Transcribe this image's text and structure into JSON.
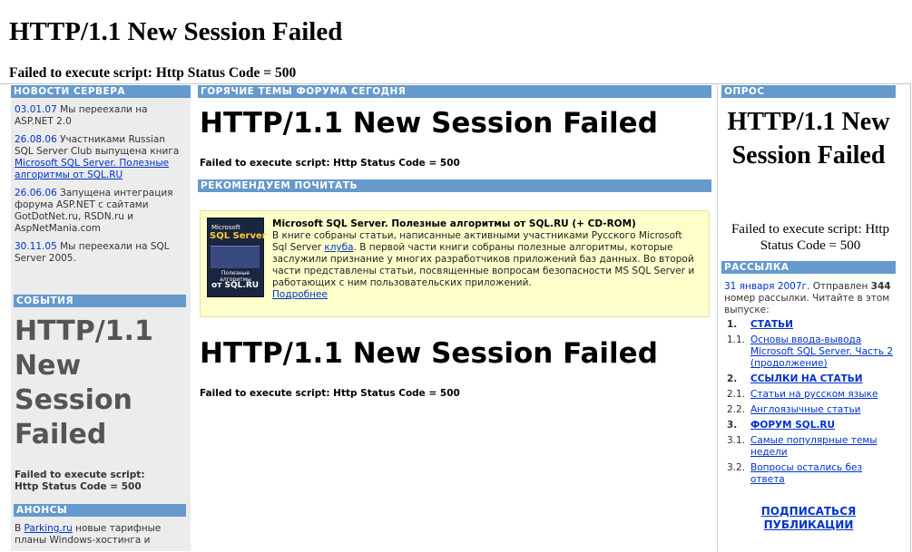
{
  "page": {
    "title": "HTTP/1.1 New Session Failed",
    "error": "Failed to execute script: Http Status Code = 500"
  },
  "left": {
    "news_header": "НОВОСТИ СЕРВЕРА",
    "news": [
      {
        "date": "03.01.07",
        "text": " Мы переехали на ASP.NET 2.0"
      },
      {
        "date": "26.08.06",
        "text": " Участниками Russian SQL Server Club выпущена книга ",
        "link": "Microsoft SQL Server. Полезные алгоритмы от SQL.RU"
      },
      {
        "date": "26.06.06",
        "text": " Запущена интеграция форума ASP.NET с сайтами GotDotNet.ru, RSDN.ru и AspNetMania.com"
      },
      {
        "date": "30.11.05",
        "text": " Мы переехали на SQL Server 2005."
      }
    ],
    "events_header": "СОБЫТИЯ",
    "events_title": "HTTP/1.1 New Session Failed",
    "events_error": "Failed to execute script: Http Status Code = 500",
    "anons_header": "АНОНСЫ",
    "anons_prefix": "В ",
    "anons_link": "Parking.ru",
    "anons_text": " новые тарифные планы Windows-хостинга и"
  },
  "center": {
    "forum_header": "ГОРЯЧИЕ ТЕМЫ ФОРУМА СЕГОДНЯ",
    "error_title_1": "HTTP/1.1 New Session Failed",
    "error_text_1": "Failed to execute script: Http Status Code = 500",
    "recommend_header": "РЕКОМЕНДУЕМ ПОЧИТАТЬ",
    "book": {
      "cover_top_small": "Microsoft",
      "cover_title": "SQL Server",
      "cover_sub": "Полезные алгоритмы",
      "cover_brand": "от SQL.RU",
      "title": "Microsoft SQL Server. Полезные алгоритмы от SQL.RU (+ CD-ROM)",
      "desc_before_link": "В книге собраны статьи, написанные активными участниками Русского Microsoft Sql Server ",
      "desc_link": "клуба",
      "desc_after_link": ". В первой части книги собраны полезные алгоритмы, которые заслужили признание у многих разработчиков приложений баз данных. Во второй части представлены статьи, посвященные вопросам безопасности MS SQL Server и работающих с ним пользовательских приложений.",
      "more_link": "Подробнее"
    },
    "error_title_2": "HTTP/1.1 New Session Failed",
    "error_text_2": "Failed to execute script: Http Status Code = 500"
  },
  "right": {
    "poll_header": "ОПРОС",
    "poll_title": "HTTP/1.1 New Session Failed",
    "poll_error": "Failed to execute script: Http Status Code = 500",
    "mailing_header": "РАССЫЛКА",
    "mailing_date": "31 января 2007г.",
    "mailing_sent": " Отправлен ",
    "mailing_num": "344",
    "mailing_tail": " номер рассылки. Читайте в этом выпуске:",
    "items": [
      {
        "num": "1.",
        "label": "СТАТЬИ",
        "bold": true
      },
      {
        "num": "1.1.",
        "label": "Основы ввода-вывода Microsoft SQL Server. Часть 2 (продолжение)",
        "bold": false
      },
      {
        "num": "2.",
        "label": "ССЫЛКИ НА СТАТЬИ",
        "bold": true
      },
      {
        "num": "2.1.",
        "label": "Статьи на русском языке",
        "bold": false
      },
      {
        "num": "2.2.",
        "label": "Англоязычные статьи",
        "bold": false
      },
      {
        "num": "3.",
        "label": "ФОРУМ SQL.RU",
        "bold": true
      },
      {
        "num": "3.1.",
        "label": "Самые популярные темы недели",
        "bold": false
      },
      {
        "num": "3.2.",
        "label": "Вопросы остались без ответа",
        "bold": false
      }
    ],
    "subscribe_link": "ПОДПИСАТЬСЯ ПУБЛИКАЦИИ"
  }
}
